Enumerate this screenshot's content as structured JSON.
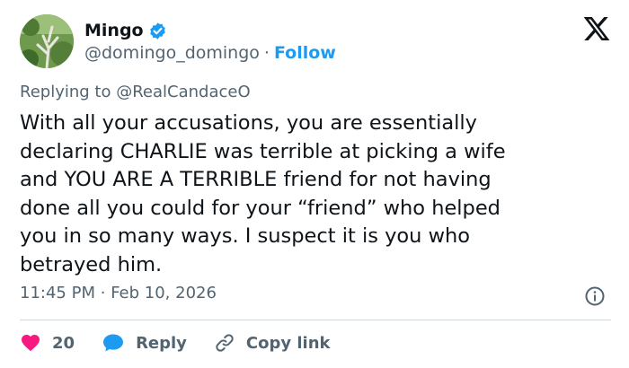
{
  "author": {
    "display_name": "Mingo",
    "handle": "@domingo_domingo",
    "separator": "·",
    "follow_label": "Follow",
    "verified_color": "#1d9bf0"
  },
  "replying": {
    "prefix": "Replying to",
    "user": "@RealCandaceO"
  },
  "body": "With all your accusations, you are essentially\ndeclaring CHARLIE was terrible at picking a wife\nand YOU ARE A TERRIBLE friend for not having\ndone all you could for your “friend” who helped\nyou in so many ways.  I suspect it is you who\nbetrayed him.",
  "meta": {
    "time": "11:45 PM",
    "separator": "·",
    "date": "Feb 10, 2026"
  },
  "actions": {
    "like_count": "20",
    "reply_label": "Reply",
    "copy_link_label": "Copy link"
  },
  "icons": {
    "brand": "x-logo-icon",
    "verified": "verified-badge-icon",
    "info": "info-icon",
    "like": "heart-icon",
    "reply": "speech-bubble-icon",
    "copy_link": "link-icon"
  },
  "colors": {
    "accent": "#1d9bf0",
    "like": "#f91880",
    "text": "#0f1419",
    "muted": "#536471"
  }
}
